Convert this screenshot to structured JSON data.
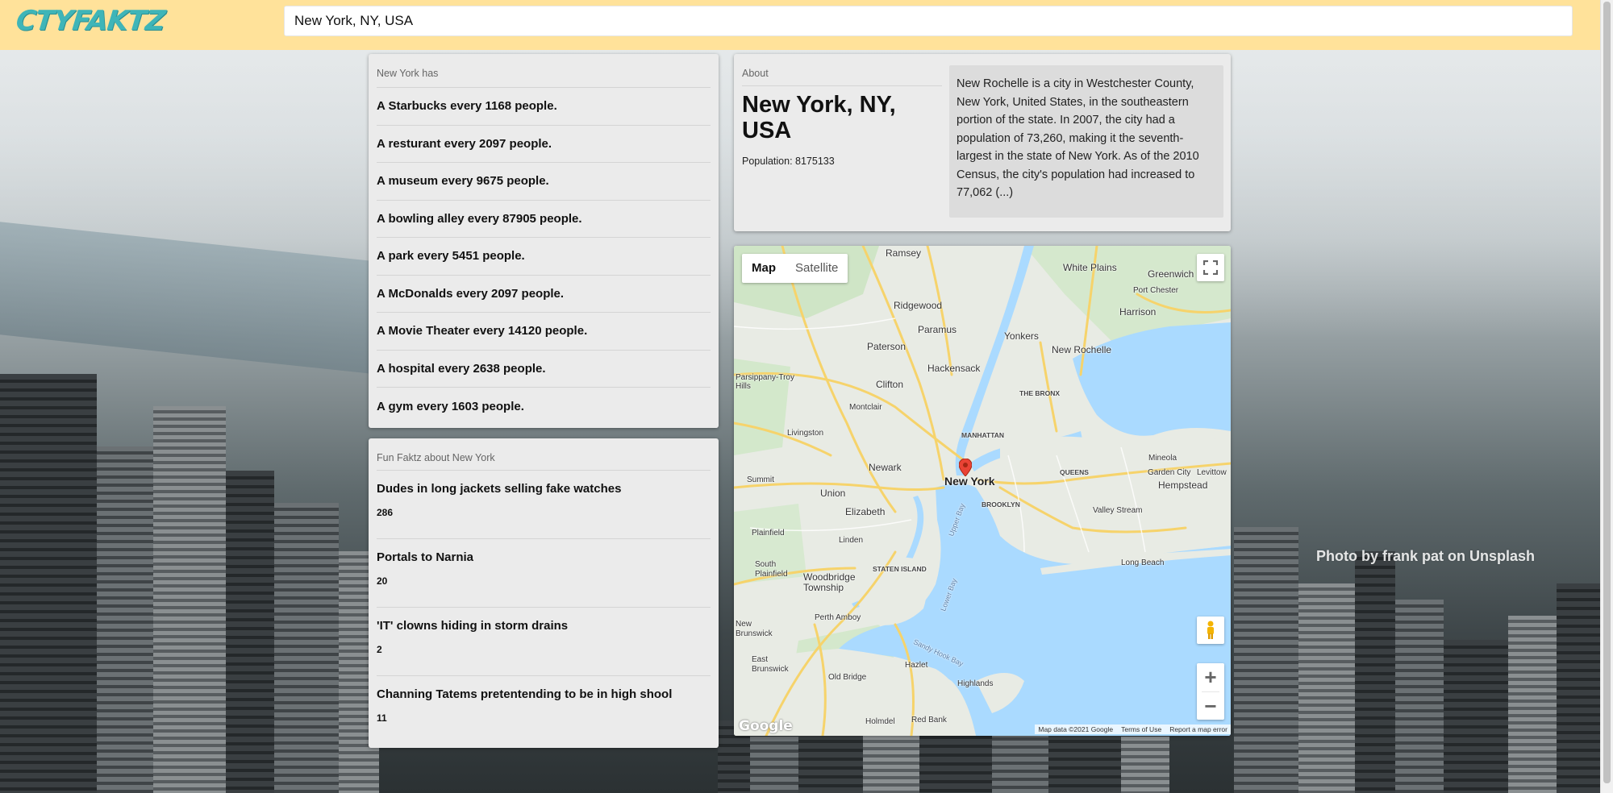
{
  "header": {
    "logo": "CTYFAKTZ",
    "search_value": "New York, NY, USA"
  },
  "city_has": {
    "title": "New York has",
    "items": [
      "A Starbucks every 1168 people.",
      "A resturant every 2097 people.",
      "A museum every 9675 people.",
      "A bowling alley every 87905 people.",
      "A park every 5451 people.",
      "A McDonalds every 2097 people.",
      "A Movie Theater every 14120 people.",
      "A hospital every 2638 people.",
      "A gym every 1603 people."
    ]
  },
  "fun_faktz": {
    "title": "Fun Faktz about New York",
    "items": [
      {
        "label": "Dudes in long jackets selling fake watches",
        "count": "286"
      },
      {
        "label": "Portals to Narnia",
        "count": "20"
      },
      {
        "label": "'IT' clowns hiding in storm drains",
        "count": "2"
      },
      {
        "label": "Channing Tatems pretentending to be in high shool",
        "count": "11"
      }
    ]
  },
  "about": {
    "title": "About",
    "city_name": "New York, NY, USA",
    "population": "Population: 8175133",
    "description": "New Rochelle is a city in Westchester County, New York, United States, in the southeastern portion of the state. In 2007, the city had a population of 73,260, making it the seventh-largest in the state of New York. As of the 2010 Census, the city's population had increased to 77,062 (...)"
  },
  "map": {
    "type_buttons": [
      "Map",
      "Satellite"
    ],
    "active_type": "Map",
    "zoom_in": "+",
    "zoom_out": "−",
    "google": "Google",
    "attribution": [
      "Map data ©2021 Google",
      "Terms of Use",
      "Report a map error"
    ],
    "labels": {
      "ramsey": "Ramsey",
      "white_plains": "White Plains",
      "greenwich": "Greenwich",
      "port_chester": "Port Chester",
      "ridgewood": "Ridgewood",
      "paramus": "Paramus",
      "harrison": "Harrison",
      "yonkers": "Yonkers",
      "paterson": "Paterson",
      "new_rochelle": "New Rochelle",
      "hackensack": "Hackensack",
      "parsippany": "Parsippany-Troy Hills",
      "clifton": "Clifton",
      "the_bronx": "THE BRONX",
      "montclair": "Montclair",
      "livingston": "Livingston",
      "manhattan": "MANHATTAN",
      "mineola": "Mineola",
      "newark": "Newark",
      "new_york": "New York",
      "queens": "QUEENS",
      "garden_city": "Garden City",
      "levittown": "Levittow",
      "summit": "Summit",
      "union": "Union",
      "hempstead": "Hempstead",
      "brooklyn": "BROOKLYN",
      "elizabeth": "Elizabeth",
      "valley_stream": "Valley Stream",
      "plainfield": "Plainfield",
      "linden": "Linden",
      "long_beach": "Long Beach",
      "south_plainfield": "South Plainfield",
      "staten_island": "STATEN ISLAND",
      "woodbridge": "Woodbridge Township",
      "perth_amboy": "Perth Amboy",
      "new_brunswick": "New Brunswick",
      "east_brunswick": "East Brunswick",
      "old_bridge": "Old Bridge",
      "hazlet": "Hazlet",
      "highlands": "Highlands",
      "holmdel": "Holmdel",
      "red_bank": "Red Bank",
      "upper_bay": "Upper Bay",
      "lower_bay": "Lower Bay",
      "sandy_hook_bay": "Sandy Hook Bay"
    }
  },
  "photo_credit": "Photo by frank pat on Unsplash"
}
